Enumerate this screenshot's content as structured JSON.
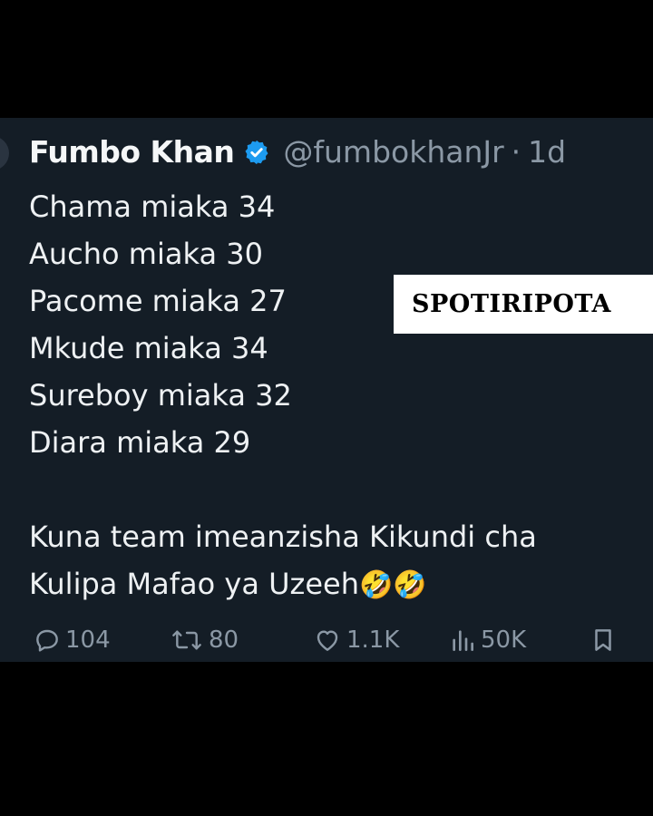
{
  "tweet": {
    "author_name": "Fumbo Khan",
    "handle": "@fumbokhanJr",
    "separator": "·",
    "time": "1d",
    "lines": [
      "Chama miaka 34",
      "Aucho miaka 30",
      "Pacome miaka 27",
      "Mkude miaka 34",
      "Sureboy miaka 32",
      "Diara miaka 29"
    ],
    "message_line1": "Kuna team imeanzisha Kikundi cha",
    "message_line2": "Kulipa Mafao ya Uzeeh",
    "emojis": "🤣🤣"
  },
  "actions": {
    "replies": "104",
    "reposts": "80",
    "likes": "1.1K",
    "views": "50K"
  },
  "watermark": "SPOTIRIPOTA",
  "colors": {
    "background": "#000000",
    "card": "#141d26",
    "text": "#eef1f3",
    "muted": "#8b98a5",
    "verified": "#1d9bf0"
  },
  "icons": [
    "verified-badge-icon",
    "reply-icon",
    "repost-icon",
    "like-icon",
    "views-icon",
    "bookmark-icon"
  ]
}
